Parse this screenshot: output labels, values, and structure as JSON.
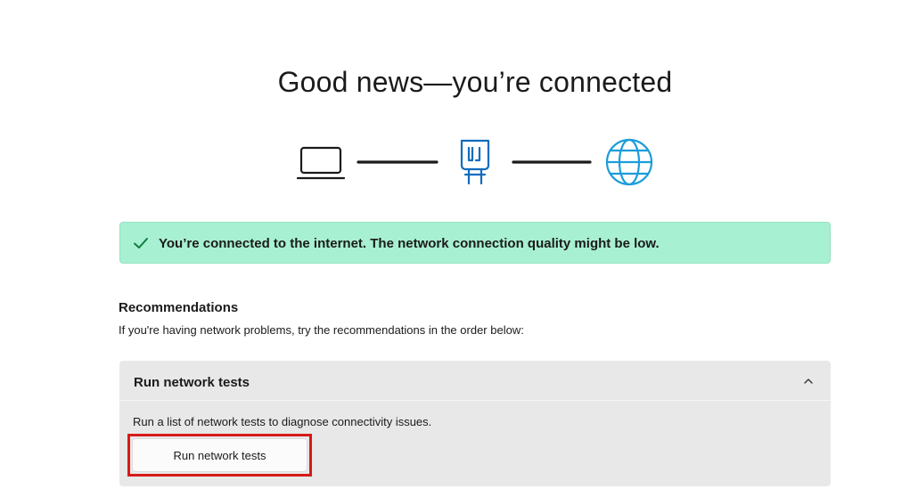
{
  "header": {
    "title": "Good news—you’re connected"
  },
  "connection_diagram": {
    "icons": [
      "laptop-icon",
      "router-icon",
      "globe-icon"
    ],
    "router_color": "#0f6cbd",
    "globe_color": "#1b9dd9",
    "laptop_color": "#1b1b1b"
  },
  "status": {
    "message": "You’re connected to the internet. The network connection quality might be low.",
    "icon": "checkmark-icon",
    "background_color": "#a8f0d2",
    "icon_color": "#0f7b3f"
  },
  "recommendations": {
    "heading": "Recommendations",
    "subtitle": "If you're having network problems, try the recommendations in the order below:",
    "items": [
      {
        "title": "Run network tests",
        "description": "Run a list of network tests to diagnose connectivity issues.",
        "button_label": "Run network tests",
        "expanded": true,
        "chevron_icon": "chevron-up-icon"
      }
    ]
  },
  "highlight_color": "#d71a1a"
}
